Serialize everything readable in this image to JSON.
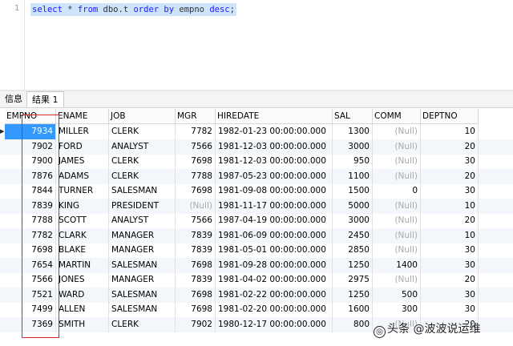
{
  "editor": {
    "line_number": "1",
    "sql_tokens": [
      {
        "t": "select",
        "k": "kw"
      },
      {
        "t": " ",
        "k": "id"
      },
      {
        "t": "*",
        "k": "id"
      },
      {
        "t": " ",
        "k": "id"
      },
      {
        "t": "from",
        "k": "kw"
      },
      {
        "t": " dbo.t ",
        "k": "id"
      },
      {
        "t": "order by",
        "k": "kw"
      },
      {
        "t": " empno ",
        "k": "id"
      },
      {
        "t": "desc",
        "k": "kw"
      },
      {
        "t": ";",
        "k": "id"
      }
    ]
  },
  "tabs": {
    "info": "信息",
    "result": "结果 1"
  },
  "columns": [
    "EMPNO",
    "ENAME",
    "JOB",
    "MGR",
    "HIREDATE",
    "SAL",
    "COMM",
    "DEPTNO"
  ],
  "rows": [
    [
      "7934",
      "MILLER",
      "CLERK",
      "7782",
      "1982-01-23 00:00:00.000",
      "1300",
      "(Null)",
      "10"
    ],
    [
      "7902",
      "FORD",
      "ANALYST",
      "7566",
      "1981-12-03 00:00:00.000",
      "3000",
      "(Null)",
      "20"
    ],
    [
      "7900",
      "JAMES",
      "CLERK",
      "7698",
      "1981-12-03 00:00:00.000",
      "950",
      "(Null)",
      "30"
    ],
    [
      "7876",
      "ADAMS",
      "CLERK",
      "7788",
      "1987-05-23 00:00:00.000",
      "1100",
      "(Null)",
      "20"
    ],
    [
      "7844",
      "TURNER",
      "SALESMAN",
      "7698",
      "1981-09-08 00:00:00.000",
      "1500",
      "0",
      "30"
    ],
    [
      "7839",
      "KING",
      "PRESIDENT",
      "(Null)",
      "1981-11-17 00:00:00.000",
      "5000",
      "(Null)",
      "10"
    ],
    [
      "7788",
      "SCOTT",
      "ANALYST",
      "7566",
      "1987-04-19 00:00:00.000",
      "3000",
      "(Null)",
      "20"
    ],
    [
      "7782",
      "CLARK",
      "MANAGER",
      "7839",
      "1981-06-09 00:00:00.000",
      "2450",
      "(Null)",
      "10"
    ],
    [
      "7698",
      "BLAKE",
      "MANAGER",
      "7839",
      "1981-05-01 00:00:00.000",
      "2850",
      "(Null)",
      "30"
    ],
    [
      "7654",
      "MARTIN",
      "SALESMAN",
      "7698",
      "1981-09-28 00:00:00.000",
      "1250",
      "1400",
      "30"
    ],
    [
      "7566",
      "JONES",
      "MANAGER",
      "7839",
      "1981-04-02 00:00:00.000",
      "2975",
      "(Null)",
      "20"
    ],
    [
      "7521",
      "WARD",
      "SALESMAN",
      "7698",
      "1981-02-22 00:00:00.000",
      "1250",
      "500",
      "30"
    ],
    [
      "7499",
      "ALLEN",
      "SALESMAN",
      "7698",
      "1981-02-20 00:00:00.000",
      "1600",
      "300",
      "30"
    ],
    [
      "7369",
      "SMITH",
      "CLERK",
      "7902",
      "1980-12-17 00:00:00.000",
      "800",
      "(Null)",
      "20"
    ]
  ],
  "watermark": {
    "icon": "toutiao-icon",
    "text": "头条 @波波说运维"
  }
}
